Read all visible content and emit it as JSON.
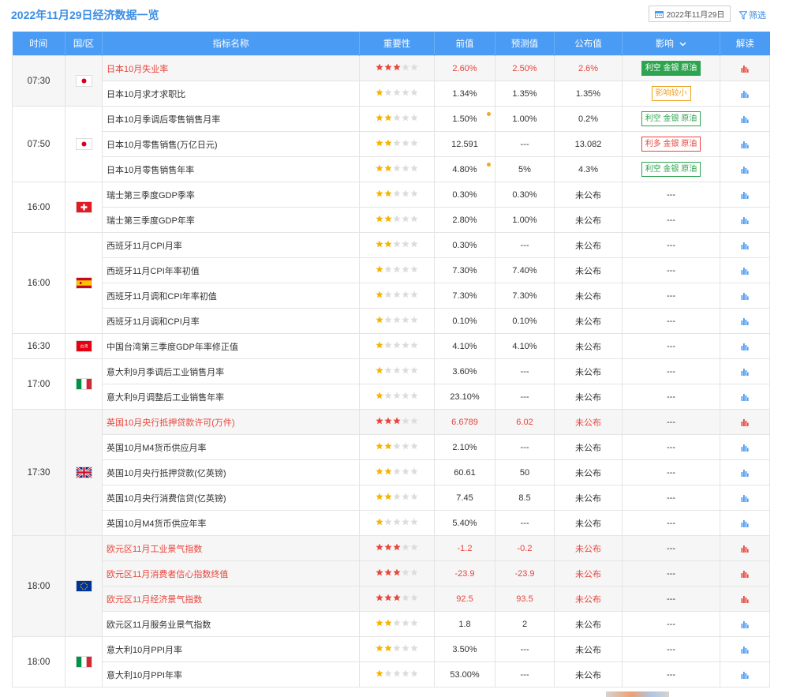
{
  "title": "2022年11月29日经济数据一览",
  "date_picker": {
    "value": "2022年11月29日",
    "icon": "calendar-icon"
  },
  "filter": {
    "label": "筛选",
    "icon": "filter-icon"
  },
  "columns": [
    "时间",
    "国/区",
    "指标名称",
    "重要性",
    "前值",
    "预测值",
    "公布值",
    "影响",
    "解读"
  ],
  "colors": {
    "header": "#4a9bf4",
    "highlight_red": "#e8453c",
    "bull_green": "#2da44e",
    "neutral_orange": "#f0a020",
    "title_blue": "#3a8ee6"
  },
  "groups": [
    {
      "time": "07:30",
      "flag": "japan",
      "rows": [
        {
          "name": "日本10月失业率",
          "stars": 3,
          "prev": "2.60%",
          "forecast": "2.50%",
          "actual": "2.6%",
          "impact": "利空 金银 原油",
          "impact_style": "solid-green",
          "hot": true,
          "shaded": true,
          "prev_dot": false
        },
        {
          "name": "日本10月求才求职比",
          "stars": 1,
          "prev": "1.34%",
          "forecast": "1.35%",
          "actual": "1.35%",
          "impact": "影响较小",
          "impact_style": "outline-orange",
          "hot": false,
          "shaded": false,
          "prev_dot": false
        }
      ]
    },
    {
      "time": "07:50",
      "flag": "japan",
      "rows": [
        {
          "name": "日本10月季调后零售销售月率",
          "stars": 2,
          "prev": "1.50%",
          "forecast": "1.00%",
          "actual": "0.2%",
          "impact": "利空 金银 原油",
          "impact_style": "outline-green",
          "hot": false,
          "shaded": false,
          "prev_dot": true
        },
        {
          "name": "日本10月零售销售(万亿日元)",
          "stars": 2,
          "prev": "12.591",
          "forecast": "---",
          "actual": "13.082",
          "impact": "利多 金银 原油",
          "impact_style": "outline-red",
          "hot": false,
          "shaded": false,
          "prev_dot": false
        },
        {
          "name": "日本10月零售销售年率",
          "stars": 2,
          "prev": "4.80%",
          "forecast": "5%",
          "actual": "4.3%",
          "impact": "利空 金银 原油",
          "impact_style": "outline-green",
          "hot": false,
          "shaded": false,
          "prev_dot": true
        }
      ]
    },
    {
      "time": "16:00",
      "flag": "switzerland",
      "rows": [
        {
          "name": "瑞士第三季度GDP季率",
          "stars": 2,
          "prev": "0.30%",
          "forecast": "0.30%",
          "actual": "未公布",
          "impact": "---",
          "impact_style": "none",
          "hot": false,
          "shaded": false,
          "prev_dot": false
        },
        {
          "name": "瑞士第三季度GDP年率",
          "stars": 2,
          "prev": "2.80%",
          "forecast": "1.00%",
          "actual": "未公布",
          "impact": "---",
          "impact_style": "none",
          "hot": false,
          "shaded": false,
          "prev_dot": false
        }
      ]
    },
    {
      "time": "16:00",
      "flag": "spain",
      "rows": [
        {
          "name": "西班牙11月CPI月率",
          "stars": 2,
          "prev": "0.30%",
          "forecast": "---",
          "actual": "未公布",
          "impact": "---",
          "impact_style": "none",
          "hot": false,
          "shaded": false,
          "prev_dot": false
        },
        {
          "name": "西班牙11月CPI年率初值",
          "stars": 1,
          "prev": "7.30%",
          "forecast": "7.40%",
          "actual": "未公布",
          "impact": "---",
          "impact_style": "none",
          "hot": false,
          "shaded": false,
          "prev_dot": false
        },
        {
          "name": "西班牙11月调和CPI年率初值",
          "stars": 1,
          "prev": "7.30%",
          "forecast": "7.30%",
          "actual": "未公布",
          "impact": "---",
          "impact_style": "none",
          "hot": false,
          "shaded": false,
          "prev_dot": false
        },
        {
          "name": "西班牙11月调和CPI月率",
          "stars": 1,
          "prev": "0.10%",
          "forecast": "0.10%",
          "actual": "未公布",
          "impact": "---",
          "impact_style": "none",
          "hot": false,
          "shaded": false,
          "prev_dot": false
        }
      ]
    },
    {
      "time": "16:30",
      "flag": "taiwan",
      "flag_label": "台湾",
      "rows": [
        {
          "name": "中国台湾第三季度GDP年率修正值",
          "stars": 1,
          "prev": "4.10%",
          "forecast": "4.10%",
          "actual": "未公布",
          "impact": "---",
          "impact_style": "none",
          "hot": false,
          "shaded": false,
          "prev_dot": false
        }
      ]
    },
    {
      "time": "17:00",
      "flag": "italy",
      "rows": [
        {
          "name": "意大利9月季调后工业销售月率",
          "stars": 1,
          "prev": "3.60%",
          "forecast": "---",
          "actual": "未公布",
          "impact": "---",
          "impact_style": "none",
          "hot": false,
          "shaded": false,
          "prev_dot": false
        },
        {
          "name": "意大利9月调整后工业销售年率",
          "stars": 1,
          "prev": "23.10%",
          "forecast": "---",
          "actual": "未公布",
          "impact": "---",
          "impact_style": "none",
          "hot": false,
          "shaded": false,
          "prev_dot": false
        }
      ]
    },
    {
      "time": "17:30",
      "flag": "uk",
      "rows": [
        {
          "name": "英国10月央行抵押贷款许可(万件)",
          "stars": 3,
          "prev": "6.6789",
          "forecast": "6.02",
          "actual": "未公布",
          "impact": "---",
          "impact_style": "none",
          "hot": true,
          "shaded": true,
          "prev_dot": false
        },
        {
          "name": "英国10月M4货币供应月率",
          "stars": 2,
          "prev": "2.10%",
          "forecast": "---",
          "actual": "未公布",
          "impact": "---",
          "impact_style": "none",
          "hot": false,
          "shaded": false,
          "prev_dot": false
        },
        {
          "name": "英国10月央行抵押贷款(亿英镑)",
          "stars": 2,
          "prev": "60.61",
          "forecast": "50",
          "actual": "未公布",
          "impact": "---",
          "impact_style": "none",
          "hot": false,
          "shaded": false,
          "prev_dot": false
        },
        {
          "name": "英国10月央行消费信贷(亿英镑)",
          "stars": 2,
          "prev": "7.45",
          "forecast": "8.5",
          "actual": "未公布",
          "impact": "---",
          "impact_style": "none",
          "hot": false,
          "shaded": false,
          "prev_dot": false
        },
        {
          "name": "英国10月M4货币供应年率",
          "stars": 1,
          "prev": "5.40%",
          "forecast": "---",
          "actual": "未公布",
          "impact": "---",
          "impact_style": "none",
          "hot": false,
          "shaded": false,
          "prev_dot": false
        }
      ]
    },
    {
      "time": "18:00",
      "flag": "eu",
      "rows": [
        {
          "name": "欧元区11月工业景气指数",
          "stars": 3,
          "prev": "-1.2",
          "forecast": "-0.2",
          "actual": "未公布",
          "impact": "---",
          "impact_style": "none",
          "hot": true,
          "shaded": true,
          "prev_dot": false
        },
        {
          "name": "欧元区11月消费者信心指数终值",
          "stars": 3,
          "prev": "-23.9",
          "forecast": "-23.9",
          "actual": "未公布",
          "impact": "---",
          "impact_style": "none",
          "hot": true,
          "shaded": true,
          "prev_dot": false
        },
        {
          "name": "欧元区11月经济景气指数",
          "stars": 3,
          "prev": "92.5",
          "forecast": "93.5",
          "actual": "未公布",
          "impact": "---",
          "impact_style": "none",
          "hot": true,
          "shaded": true,
          "prev_dot": false
        },
        {
          "name": "欧元区11月服务业景气指数",
          "stars": 2,
          "prev": "1.8",
          "forecast": "2",
          "actual": "未公布",
          "impact": "---",
          "impact_style": "none",
          "hot": false,
          "shaded": false,
          "prev_dot": false
        }
      ]
    },
    {
      "time": "18:00",
      "flag": "italy",
      "rows": [
        {
          "name": "意大利10月PPI月率",
          "stars": 2,
          "prev": "3.50%",
          "forecast": "---",
          "actual": "未公布",
          "impact": "---",
          "impact_style": "none",
          "hot": false,
          "shaded": false,
          "prev_dot": false
        },
        {
          "name": "意大利10月PPI年率",
          "stars": 1,
          "prev": "53.00%",
          "forecast": "---",
          "actual": "未公布",
          "impact": "---",
          "impact_style": "none",
          "hot": false,
          "shaded": false,
          "prev_dot": false
        }
      ]
    }
  ]
}
